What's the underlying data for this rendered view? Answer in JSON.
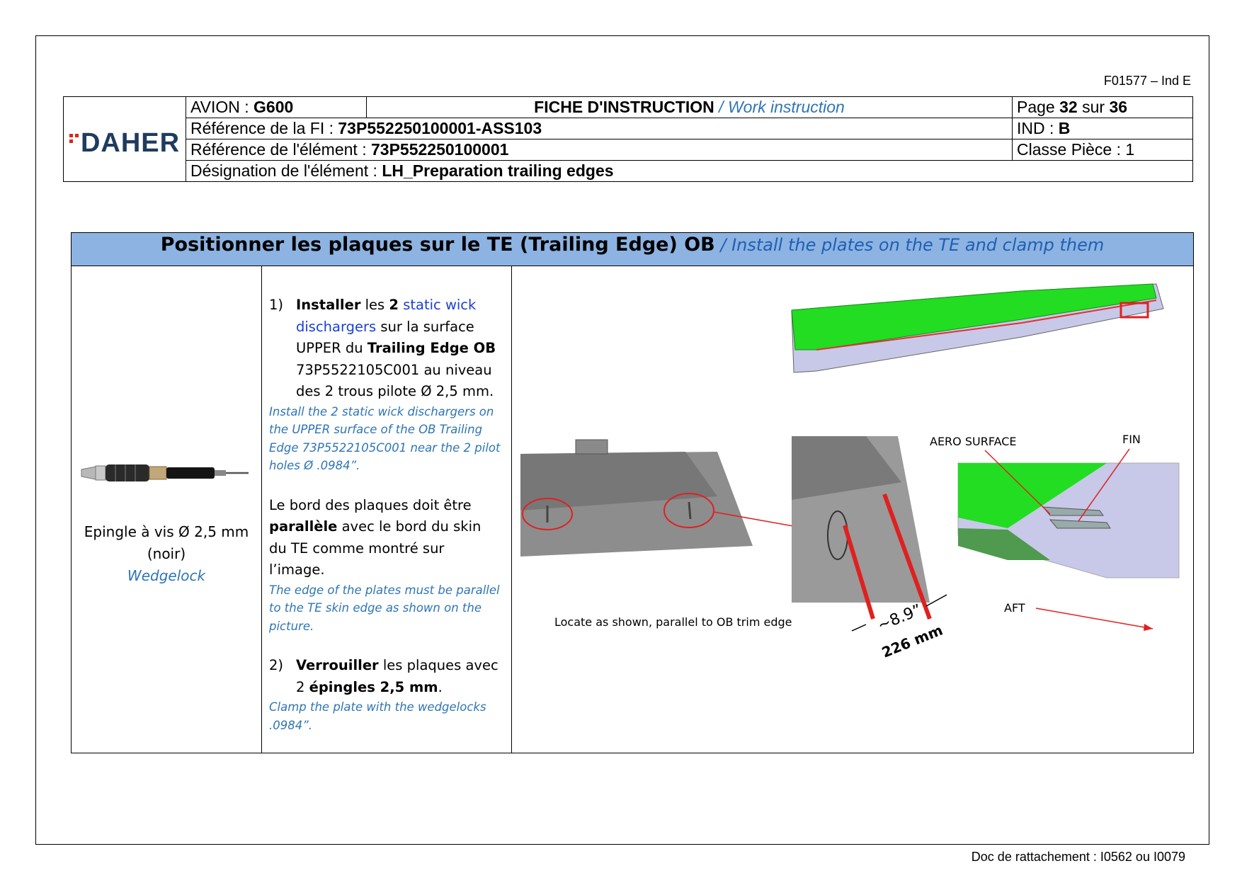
{
  "form_ref": "F01577 – Ind E",
  "footer": "Doc de rattachement : I0562 ou I0079",
  "header": {
    "logo_text": "DAHER",
    "avion_label": "AVION : ",
    "avion_value": "G600",
    "doc_title": "FICHE D'INSTRUCTION",
    "doc_title_en": " / Work instruction",
    "page_label": "Page ",
    "page_number": "32",
    "page_sur": " sur ",
    "page_total": "36",
    "ref_fi_label": "Référence de la FI : ",
    "ref_fi_value": "73P552250100001-ASS103",
    "ind_label": "IND : ",
    "ind_value": "B",
    "ref_elem_label": "Référence de l'élément : ",
    "ref_elem_value": "73P552250100001",
    "classe_label": "Classe Pièce : 1",
    "design_label": "Désignation de l'élément : ",
    "design_value": "LH_Preparation trailing edges"
  },
  "section": {
    "title": "Positionner les plaques sur le TE (Trailing Edge) OB",
    "title_en": " / Install the plates on the TE and clamp them"
  },
  "tool": {
    "caption_line1": "Epingle à vis Ø 2,5 mm",
    "caption_line2": "(noir)",
    "caption_en": "Wedgelock"
  },
  "steps": {
    "s1_num": "1)",
    "s1_a": "Installer",
    "s1_b": " les ",
    "s1_c": "2",
    "s1_d": " ",
    "s1_e": "static wick dischargers",
    "s1_f": " sur la surface UPPER du ",
    "s1_g": "Trailing Edge OB",
    "s1_h": " 73P5522105C001 au niveau des 2 trous pilote Ø 2,5 mm.",
    "s1_en": "Install the 2 static wick dischargers on the UPPER surface of the OB Trailing Edge 73P5522105C001 near the 2 pilot holes Ø .0984”.",
    "p_a": "Le bord des plaques doit être ",
    "p_b": "parallèle",
    "p_c": " avec le bord du skin du TE comme montré sur l’image.",
    "p_en": "The edge of the plates must be parallel to the TE skin edge as shown on the picture.",
    "s2_num": "2)",
    "s2_a": "Verrouiller",
    "s2_b": " les plaques avec 2 ",
    "s2_c": "épingles 2,5 mm",
    "s2_d": ".",
    "s2_en": "Clamp the plate with the wedgelocks .0984”."
  },
  "figure": {
    "aero_surface": "AERO SURFACE",
    "fin": "FIN",
    "aft": "AFT",
    "locate_caption": "Locate as shown, parallel to OB trim edge",
    "dim_in": "~8.9”",
    "dim_mm": "226 mm"
  },
  "colors": {
    "header_blue": "#8db3e2",
    "logo_navy": "#1f3b5e",
    "logo_red": "#e2231a",
    "english_blue": "#2e75b6",
    "link_blue": "#1a3fd6",
    "part_green": "#22dd22",
    "annotation_red": "#e02020"
  }
}
